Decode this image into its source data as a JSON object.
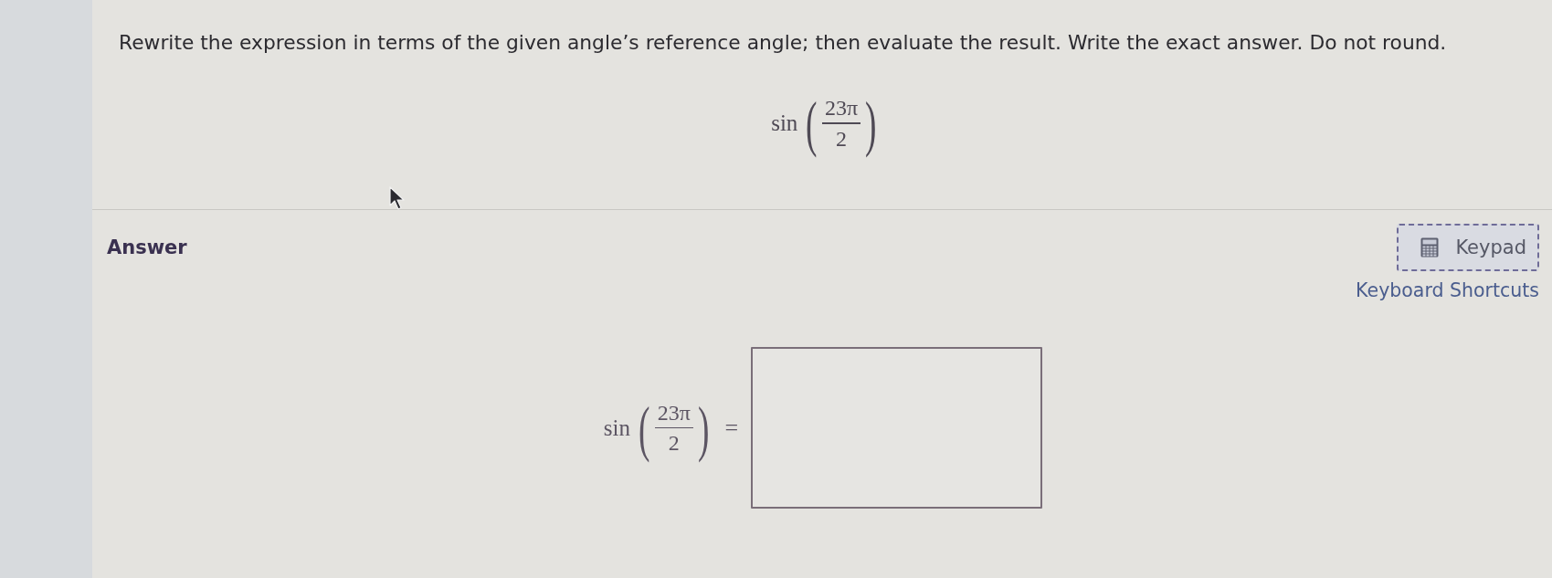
{
  "question": {
    "prompt": "Rewrite the expression in terms of the given angle’s reference angle; then evaluate the result. Write the exact answer. Do not round.",
    "expression": {
      "function": "sin",
      "left_paren": "(",
      "numerator": "23π",
      "denominator": "2",
      "right_paren": ")"
    }
  },
  "answer": {
    "heading": "Answer",
    "keypad_button": {
      "label": "Keypad"
    },
    "shortcuts_link": "Keyboard Shortcuts",
    "equation": {
      "function": "sin",
      "left_paren": "(",
      "numerator": "23π",
      "denominator": "2",
      "right_paren": ")",
      "equals": "="
    }
  }
}
